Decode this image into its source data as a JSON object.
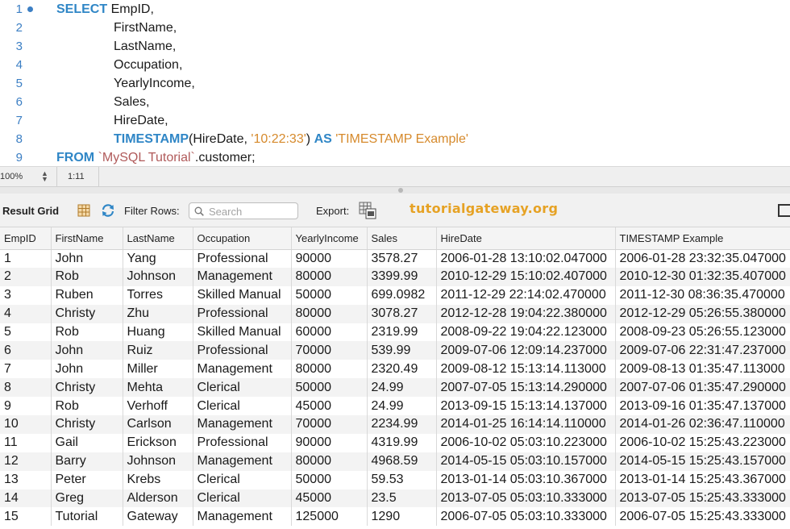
{
  "editor": {
    "lines": [
      {
        "num": "1",
        "breakpoint": true,
        "indent": false,
        "tokens": [
          {
            "t": "SELECT",
            "c": "kw"
          },
          {
            "t": " EmpID,",
            "c": ""
          }
        ]
      },
      {
        "num": "2",
        "breakpoint": false,
        "indent": true,
        "tokens": [
          {
            "t": "FirstName,",
            "c": ""
          }
        ]
      },
      {
        "num": "3",
        "breakpoint": false,
        "indent": true,
        "tokens": [
          {
            "t": "LastName,",
            "c": ""
          }
        ]
      },
      {
        "num": "4",
        "breakpoint": false,
        "indent": true,
        "tokens": [
          {
            "t": "Occupation,",
            "c": ""
          }
        ]
      },
      {
        "num": "5",
        "breakpoint": false,
        "indent": true,
        "tokens": [
          {
            "t": "YearlyIncome,",
            "c": ""
          }
        ]
      },
      {
        "num": "6",
        "breakpoint": false,
        "indent": true,
        "tokens": [
          {
            "t": "Sales,",
            "c": ""
          }
        ]
      },
      {
        "num": "7",
        "breakpoint": false,
        "indent": true,
        "tokens": [
          {
            "t": "HireDate,",
            "c": ""
          }
        ]
      },
      {
        "num": "8",
        "breakpoint": false,
        "indent": true,
        "tokens": [
          {
            "t": "TIMESTAMP",
            "c": "kw"
          },
          {
            "t": "(HireDate, ",
            "c": ""
          },
          {
            "t": "'10:22:33'",
            "c": "str"
          },
          {
            "t": ") ",
            "c": ""
          },
          {
            "t": "AS",
            "c": "kw"
          },
          {
            "t": " ",
            "c": ""
          },
          {
            "t": "'TIMESTAMP Example'",
            "c": "str"
          }
        ]
      },
      {
        "num": "9",
        "breakpoint": false,
        "indent": false,
        "tokens": [
          {
            "t": "FROM",
            "c": "kw"
          },
          {
            "t": " ",
            "c": ""
          },
          {
            "t": "`MySQL Tutorial`",
            "c": "bt"
          },
          {
            "t": ".customer;",
            "c": ""
          }
        ]
      }
    ]
  },
  "statusbar": {
    "zoom": "100%",
    "cursor_position": "1:11"
  },
  "toolbar": {
    "title": "Result Grid",
    "filter_label": "Filter Rows:",
    "search_placeholder": "Search",
    "export_label": "Export:",
    "brand": "tutorialgateway.org"
  },
  "grid": {
    "columns": [
      "EmpID",
      "FirstName",
      "LastName",
      "Occupation",
      "YearlyIncome",
      "Sales",
      "HireDate",
      "TIMESTAMP Example"
    ],
    "rows": [
      [
        "1",
        "John",
        "Yang",
        "Professional",
        "90000",
        "3578.27",
        "2006-01-28 13:10:02.047000",
        "2006-01-28 23:32:35.047000"
      ],
      [
        "2",
        "Rob",
        "Johnson",
        "Management",
        "80000",
        "3399.99",
        "2010-12-29 15:10:02.407000",
        "2010-12-30 01:32:35.407000"
      ],
      [
        "3",
        "Ruben",
        "Torres",
        "Skilled Manual",
        "50000",
        "699.0982",
        "2011-12-29 22:14:02.470000",
        "2011-12-30 08:36:35.470000"
      ],
      [
        "4",
        "Christy",
        "Zhu",
        "Professional",
        "80000",
        "3078.27",
        "2012-12-28 19:04:22.380000",
        "2012-12-29 05:26:55.380000"
      ],
      [
        "5",
        "Rob",
        "Huang",
        "Skilled Manual",
        "60000",
        "2319.99",
        "2008-09-22 19:04:22.123000",
        "2008-09-23 05:26:55.123000"
      ],
      [
        "6",
        "John",
        "Ruiz",
        "Professional",
        "70000",
        "539.99",
        "2009-07-06 12:09:14.237000",
        "2009-07-06 22:31:47.237000"
      ],
      [
        "7",
        "John",
        "Miller",
        "Management",
        "80000",
        "2320.49",
        "2009-08-12 15:13:14.113000",
        "2009-08-13 01:35:47.113000"
      ],
      [
        "8",
        "Christy",
        "Mehta",
        "Clerical",
        "50000",
        "24.99",
        "2007-07-05 15:13:14.290000",
        "2007-07-06 01:35:47.290000"
      ],
      [
        "9",
        "Rob",
        "Verhoff",
        "Clerical",
        "45000",
        "24.99",
        "2013-09-15 15:13:14.137000",
        "2013-09-16 01:35:47.137000"
      ],
      [
        "10",
        "Christy",
        "Carlson",
        "Management",
        "70000",
        "2234.99",
        "2014-01-25 16:14:14.110000",
        "2014-01-26 02:36:47.110000"
      ],
      [
        "11",
        "Gail",
        "Erickson",
        "Professional",
        "90000",
        "4319.99",
        "2006-10-02 05:03:10.223000",
        "2006-10-02 15:25:43.223000"
      ],
      [
        "12",
        "Barry",
        "Johnson",
        "Management",
        "80000",
        "4968.59",
        "2014-05-15 05:03:10.157000",
        "2014-05-15 15:25:43.157000"
      ],
      [
        "13",
        "Peter",
        "Krebs",
        "Clerical",
        "50000",
        "59.53",
        "2013-01-14 05:03:10.367000",
        "2013-01-14 15:25:43.367000"
      ],
      [
        "14",
        "Greg",
        "Alderson",
        "Clerical",
        "45000",
        "23.5",
        "2013-07-05 05:03:10.333000",
        "2013-07-05 15:25:43.333000"
      ],
      [
        "15",
        "Tutorial",
        "Gateway",
        "Management",
        "125000",
        "1290",
        "2006-07-05 05:03:10.333000",
        "2006-07-05 15:25:43.333000"
      ]
    ]
  }
}
